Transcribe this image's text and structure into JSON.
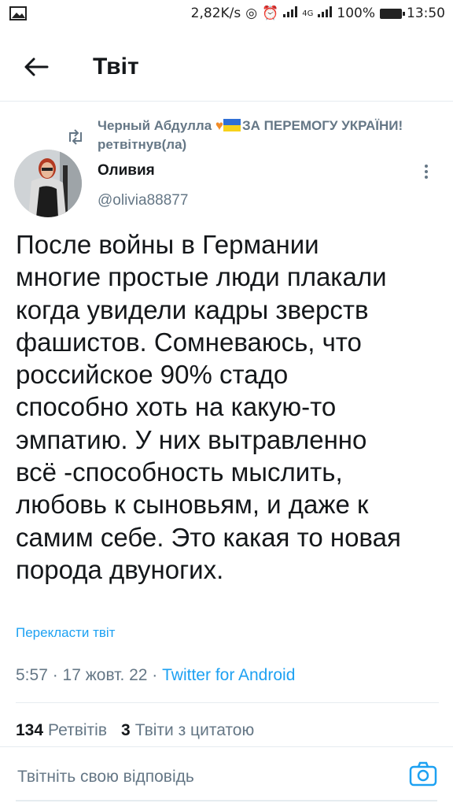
{
  "status_bar": {
    "speed": "2,82K/s",
    "network": "4G",
    "battery": "100%",
    "time": "13:50"
  },
  "header": {
    "title": "Твіт"
  },
  "retweet": {
    "text_before_icons": "Черный Абдулла ",
    "text_after_icons": "ЗА ПЕРЕМОГУ УКРАЇНИ! ретвітнув(ла)"
  },
  "author": {
    "name": "Оливия",
    "handle": "@olivia88877"
  },
  "tweet": {
    "text": "После войны в Германии\nмногие простые люди плакали\nкогда увидели кадры зверств\nфашистов. Сомневаюсь, что\nроссийское 90% стадо\nспособно хоть на какую-то\nэмпатию. У них вытравленно\nвсё -способность мыслить,\nлюбовь к сыновьям, и даже к\nсамим себе. Это какая то новая\nпорода двуногих.",
    "translate_label": "Перекласти твіт",
    "time": "5:57 · 17 жовт. 22 · ",
    "source": "Twitter for Android"
  },
  "stats": {
    "retweets_count": "134",
    "retweets_label": "Ретвітів",
    "quotes_count": "3",
    "quotes_label": "Твіти з цитатою"
  },
  "reply": {
    "placeholder": "Твітніть свою відповідь"
  },
  "colors": {
    "accent": "#1da1f2",
    "secondary_text": "#657786",
    "primary_text": "#14171a"
  }
}
